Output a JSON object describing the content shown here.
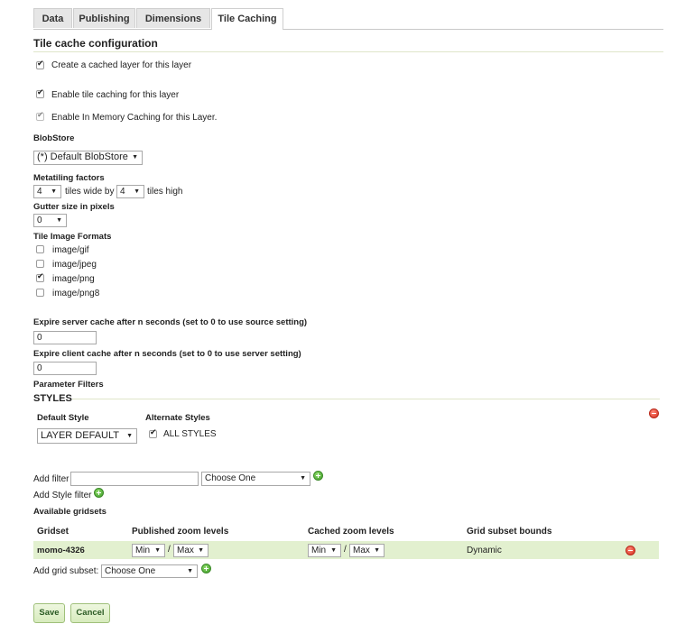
{
  "tabs": [
    {
      "label": "Data"
    },
    {
      "label": "Publishing"
    },
    {
      "label": "Dimensions"
    },
    {
      "label": "Tile Caching",
      "active": true
    }
  ],
  "section_title": "Tile cache configuration",
  "create_cached_layer": {
    "label": "Create a cached layer for this layer",
    "checked": true
  },
  "enable_tile_caching": {
    "label": "Enable tile caching for this layer",
    "checked": true
  },
  "enable_in_memory": {
    "label": "Enable In Memory Caching for this Layer.",
    "checked": true,
    "disabled": true
  },
  "blobstore": {
    "label": "BlobStore",
    "value": "(*) Default BlobStore"
  },
  "metatiling": {
    "label": "Metatiling factors",
    "wide_value": "4",
    "wide_text": "tiles wide by",
    "high_value": "4",
    "high_text": "tiles high"
  },
  "gutter": {
    "label": "Gutter size in pixels",
    "value": "0"
  },
  "tile_formats": {
    "label": "Tile Image Formats",
    "items": [
      {
        "label": "image/gif",
        "checked": false
      },
      {
        "label": "image/jpeg",
        "checked": false
      },
      {
        "label": "image/png",
        "checked": true
      },
      {
        "label": "image/png8",
        "checked": false
      }
    ]
  },
  "expire_server": {
    "label": "Expire server cache after n seconds (set to 0 to use source setting)",
    "value": "0"
  },
  "expire_client": {
    "label": "Expire client cache after n seconds (set to 0 to use server setting)",
    "value": "0"
  },
  "parameter_filters": {
    "label": "Parameter Filters"
  },
  "styles": {
    "title": "STYLES",
    "default_label": "Default Style",
    "alternate_label": "Alternate Styles",
    "default_value": "LAYER DEFAULT",
    "all_styles_label": "ALL STYLES",
    "all_styles_checked": true
  },
  "add_filter": {
    "label": "Add filter",
    "input_value": "",
    "choose_value": "Choose One"
  },
  "add_style_filter": {
    "label": "Add Style filter"
  },
  "gridsets": {
    "title": "Available gridsets",
    "headers": [
      "Gridset",
      "Published zoom levels",
      "Cached zoom levels",
      "Grid subset bounds"
    ],
    "rows": [
      {
        "name": "momo-4326",
        "pub_min": "Min",
        "pub_max": "Max",
        "cache_min": "Min",
        "cache_max": "Max",
        "separator": "/",
        "bounds": "Dynamic"
      }
    ]
  },
  "add_grid_subset": {
    "label": "Add grid subset:",
    "value": "Choose One"
  },
  "buttons": {
    "save": "Save",
    "cancel": "Cancel"
  },
  "colors": {
    "accent_green": "#e2f0cf",
    "rule": "#dfe6c9",
    "add": "#3c9a26",
    "remove": "#d42a1a"
  }
}
